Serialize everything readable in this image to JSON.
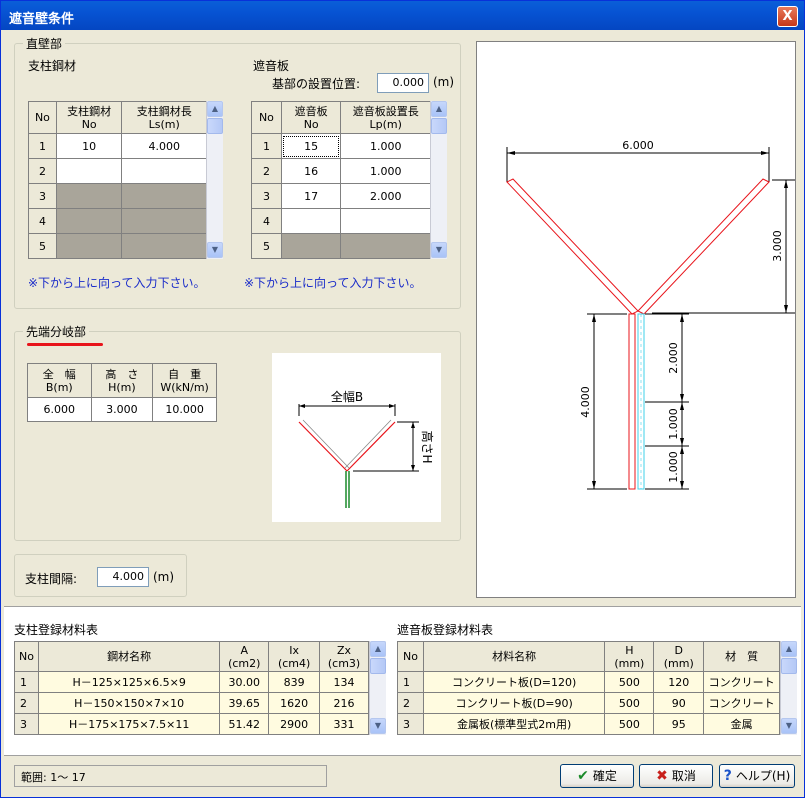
{
  "window": {
    "title": "遮音壁条件",
    "close_glyph": "X"
  },
  "straight": {
    "group_label": "直壁部",
    "post_label": "支柱鋼材",
    "post_cols": [
      "No",
      "支柱鋼材\nNo",
      "支柱鋼材長\nLs(m)"
    ],
    "post_rows": [
      [
        "1",
        "10",
        "4.000"
      ],
      [
        "2",
        "",
        ""
      ],
      [
        "3",
        "",
        ""
      ],
      [
        "4",
        "",
        ""
      ],
      [
        "5",
        "",
        ""
      ]
    ],
    "post_note": "※下から上に向って入力下さい。",
    "barrier_label": "遮音板",
    "base_pos_label": "基部の設置位置:",
    "base_pos_value": "0.000",
    "base_pos_unit": "(m)",
    "barrier_cols": [
      "No",
      "遮音板\nNo",
      "遮音板設置長\nLp(m)"
    ],
    "barrier_rows": [
      [
        "1",
        "15",
        "1.000"
      ],
      [
        "2",
        "16",
        "1.000"
      ],
      [
        "3",
        "17",
        "2.000"
      ],
      [
        "4",
        "",
        ""
      ],
      [
        "5",
        "",
        ""
      ]
    ],
    "barrier_note": "※下から上に向って入力下さい。"
  },
  "tip": {
    "group_label": "先端分岐部",
    "cols": [
      "全　幅\nB(m)",
      "高　さ\nH(m)",
      "自　重\nW(kN/m)"
    ],
    "values": [
      "6.000",
      "3.000",
      "10.000"
    ],
    "diagram_width_label": "全幅B",
    "diagram_height_label": "高さH"
  },
  "spacing": {
    "label": "支柱間隔:",
    "value": "4.000",
    "unit": "(m)"
  },
  "preview": {
    "width_label": "6.000",
    "height_label": "3.000",
    "post_label": "4.000",
    "seg_labels": [
      "2.000",
      "1.000",
      "1.000"
    ]
  },
  "post_materials": {
    "title": "支柱登録材料表",
    "cols": [
      "No",
      "鋼材名称",
      "A\n(cm2)",
      "Ix\n(cm4)",
      "Zx\n(cm3)"
    ],
    "rows": [
      [
        "1",
        "H－125×125×6.5×9",
        "30.00",
        "839",
        "134"
      ],
      [
        "2",
        "H－150×150×7×10",
        "39.65",
        "1620",
        "216"
      ],
      [
        "3",
        "H－175×175×7.5×11",
        "51.42",
        "2900",
        "331"
      ]
    ]
  },
  "barrier_materials": {
    "title": "遮音板登録材料表",
    "cols": [
      "No",
      "材料名称",
      "H\n(mm)",
      "D\n(mm)",
      "材　質"
    ],
    "rows": [
      [
        "1",
        "コンクリート板(D=120)",
        "500",
        "120",
        "コンクリート"
      ],
      [
        "2",
        "コンクリート板(D=90)",
        "500",
        "90",
        "コンクリート"
      ],
      [
        "3",
        "金属板(標準型式2m用)",
        "500",
        "95",
        "金属"
      ]
    ]
  },
  "footer": {
    "status": "範囲:  1～ 17",
    "ok_label": "確定",
    "cancel_label": "取消",
    "help_label": "ヘルプ(H)"
  },
  "colors": {
    "accent_red": "#e8141b",
    "post_green": "#1a8a2a",
    "barrier_cyan": "#3fd0ea",
    "title_blue": "#0753d3"
  }
}
